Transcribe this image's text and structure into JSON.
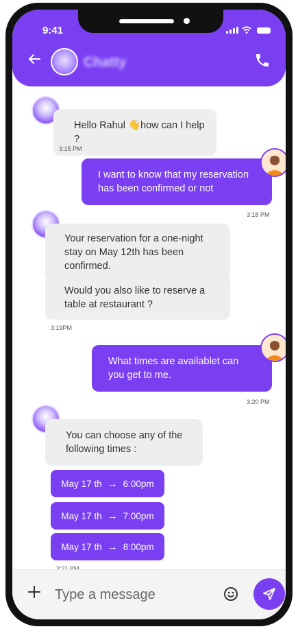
{
  "status_bar": {
    "time": "9:41"
  },
  "header": {
    "title": "Chatty"
  },
  "messages": [
    {
      "sender": "bot",
      "text": "Hello Rahul 👋how can I help ?",
      "time": "3:15 PM"
    },
    {
      "sender": "user",
      "text": "I want to know that my reservation has been confirmed or not",
      "time": "3:18 PM"
    },
    {
      "sender": "bot",
      "text": "Your reservation for a one-night stay on May 12th has been confirmed."
    },
    {
      "sender": "bot",
      "text": "Would you also like to reserve a table at restaurant ?",
      "time": "3:19PM"
    },
    {
      "sender": "user",
      "text": "What times are availablet can you get to me.",
      "time": "3:20 PM"
    },
    {
      "sender": "bot",
      "text": "You can choose any of the following times :"
    }
  ],
  "time_options": [
    {
      "date": "May 17 th",
      "arrow": "→",
      "time": "6:00pm"
    },
    {
      "date": "May 17 th",
      "arrow": "→",
      "time": "7:00pm"
    },
    {
      "date": "May 17 th",
      "arrow": "→",
      "time": "8:00pm"
    }
  ],
  "options_time": "3:21 PM",
  "composer": {
    "placeholder": "Type a message"
  },
  "colors": {
    "accent": "#7b3ff2",
    "bot_bubble": "#eeeeee"
  }
}
